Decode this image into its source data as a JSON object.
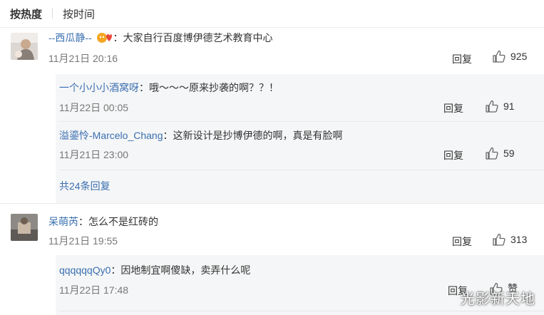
{
  "sort": {
    "hot_label": "按热度",
    "time_label": "按时间"
  },
  "comments": [
    {
      "user": "--西瓜静--",
      "text": "：大家自行百度博伊德艺术教育中心",
      "time": "11月21日 20:16",
      "reply_label": "回复",
      "likes": "925",
      "replies": [
        {
          "user": "一个小小小酒窝呀",
          "text": "：哦～～～原来抄袭的啊？？！",
          "time": "11月22日 00:05",
          "reply_label": "回复",
          "likes": "91"
        },
        {
          "user": "溢鎏怜-Marcelo_Chang",
          "text": "：这新设计是抄博伊德的啊，真是有脸啊",
          "time": "11月21日 23:00",
          "reply_label": "回复",
          "likes": "59"
        }
      ],
      "more_replies": "共24条回复"
    },
    {
      "user": "呆萌芮",
      "text": "：怎么不是红砖的",
      "time": "11月21日 19:55",
      "reply_label": "回复",
      "likes": "313",
      "replies": [
        {
          "user": "qqqqqqQy0",
          "text": "：因地制宜啊傻缺，卖弄什么呢",
          "time": "11月22日 17:48",
          "reply_label": "回复",
          "likes": "赞"
        }
      ]
    }
  ],
  "watermark": "光影新天地",
  "colors": {
    "username": "#3a6fb0",
    "reply_bg": "#f5f6f7",
    "time": "#777777"
  }
}
